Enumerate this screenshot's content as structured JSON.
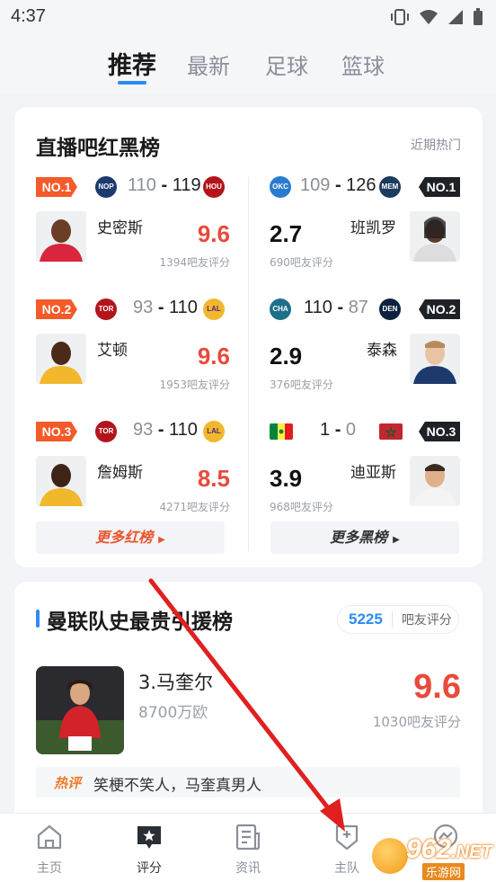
{
  "status_bar": {
    "time": "4:37"
  },
  "top_tabs": [
    {
      "label": "推荐",
      "active": true
    },
    {
      "label": "最新",
      "active": false
    },
    {
      "label": "足球",
      "active": false
    },
    {
      "label": "篮球",
      "active": false
    }
  ],
  "ranking_card": {
    "title": "直播吧红黑榜",
    "hint": "近期热门",
    "red_list": [
      {
        "rank": "NO.1",
        "home_logo": "NOP",
        "home_score": "110",
        "sep": "-",
        "away_score": "119",
        "away_logo": "HOU",
        "player": "史密斯",
        "rating": "9.6",
        "votes": "1394吧友评分"
      },
      {
        "rank": "NO.2",
        "home_logo": "TOR",
        "home_score": "93",
        "sep": "-",
        "away_score": "110",
        "away_logo": "LAL",
        "player": "艾顿",
        "rating": "9.6",
        "votes": "1953吧友评分"
      },
      {
        "rank": "NO.3",
        "home_logo": "TOR",
        "home_score": "93",
        "sep": "-",
        "away_score": "110",
        "away_logo": "LAL",
        "player": "詹姆斯",
        "rating": "8.5",
        "votes": "4271吧友评分"
      }
    ],
    "black_list": [
      {
        "rank": "NO.1",
        "home_logo": "OKC",
        "home_score": "109",
        "sep": "-",
        "away_score": "126",
        "away_logo": "MEM",
        "player": "班凯罗",
        "rating": "2.7",
        "votes": "690吧友评分"
      },
      {
        "rank": "NO.2",
        "home_logo": "CHA",
        "home_score": "110",
        "sep": "-",
        "away_score": "87",
        "away_logo": "DEN",
        "player": "泰森",
        "rating": "2.9",
        "votes": "376吧友评分"
      },
      {
        "rank": "NO.3",
        "home_logo": "",
        "home_score": "1",
        "sep": "-",
        "away_score": "0",
        "away_logo": "",
        "player": "迪亚斯",
        "rating": "3.9",
        "votes": "968吧友评分"
      }
    ],
    "more_red": "更多红榜",
    "more_black": "更多黑榜"
  },
  "transfer_card": {
    "title": "曼联队史最贵引援榜",
    "score_num": "5225",
    "score_label": "吧友评分",
    "player_name": "3.马奎尔",
    "fee": "8700万欧",
    "rating": "9.6",
    "votes": "1030吧友评分",
    "hot_tag": "热评",
    "hot_text": "笑梗不笑人，马奎真男人"
  },
  "bottom_nav": [
    {
      "label": "主页",
      "icon": "home-icon"
    },
    {
      "label": "评分",
      "icon": "rating-star-icon"
    },
    {
      "label": "资讯",
      "icon": "news-icon"
    },
    {
      "label": "主队",
      "icon": "team-shield-icon"
    },
    {
      "label": "",
      "icon": "messenger-icon"
    }
  ],
  "watermark": {
    "num": "962",
    "net": ".NET",
    "sub": "乐游网"
  },
  "colors": {
    "accent_blue": "#2a8cf0",
    "red": "#e84a3c",
    "rank_red": "#f45a2a",
    "rank_black": "#1e2226"
  }
}
